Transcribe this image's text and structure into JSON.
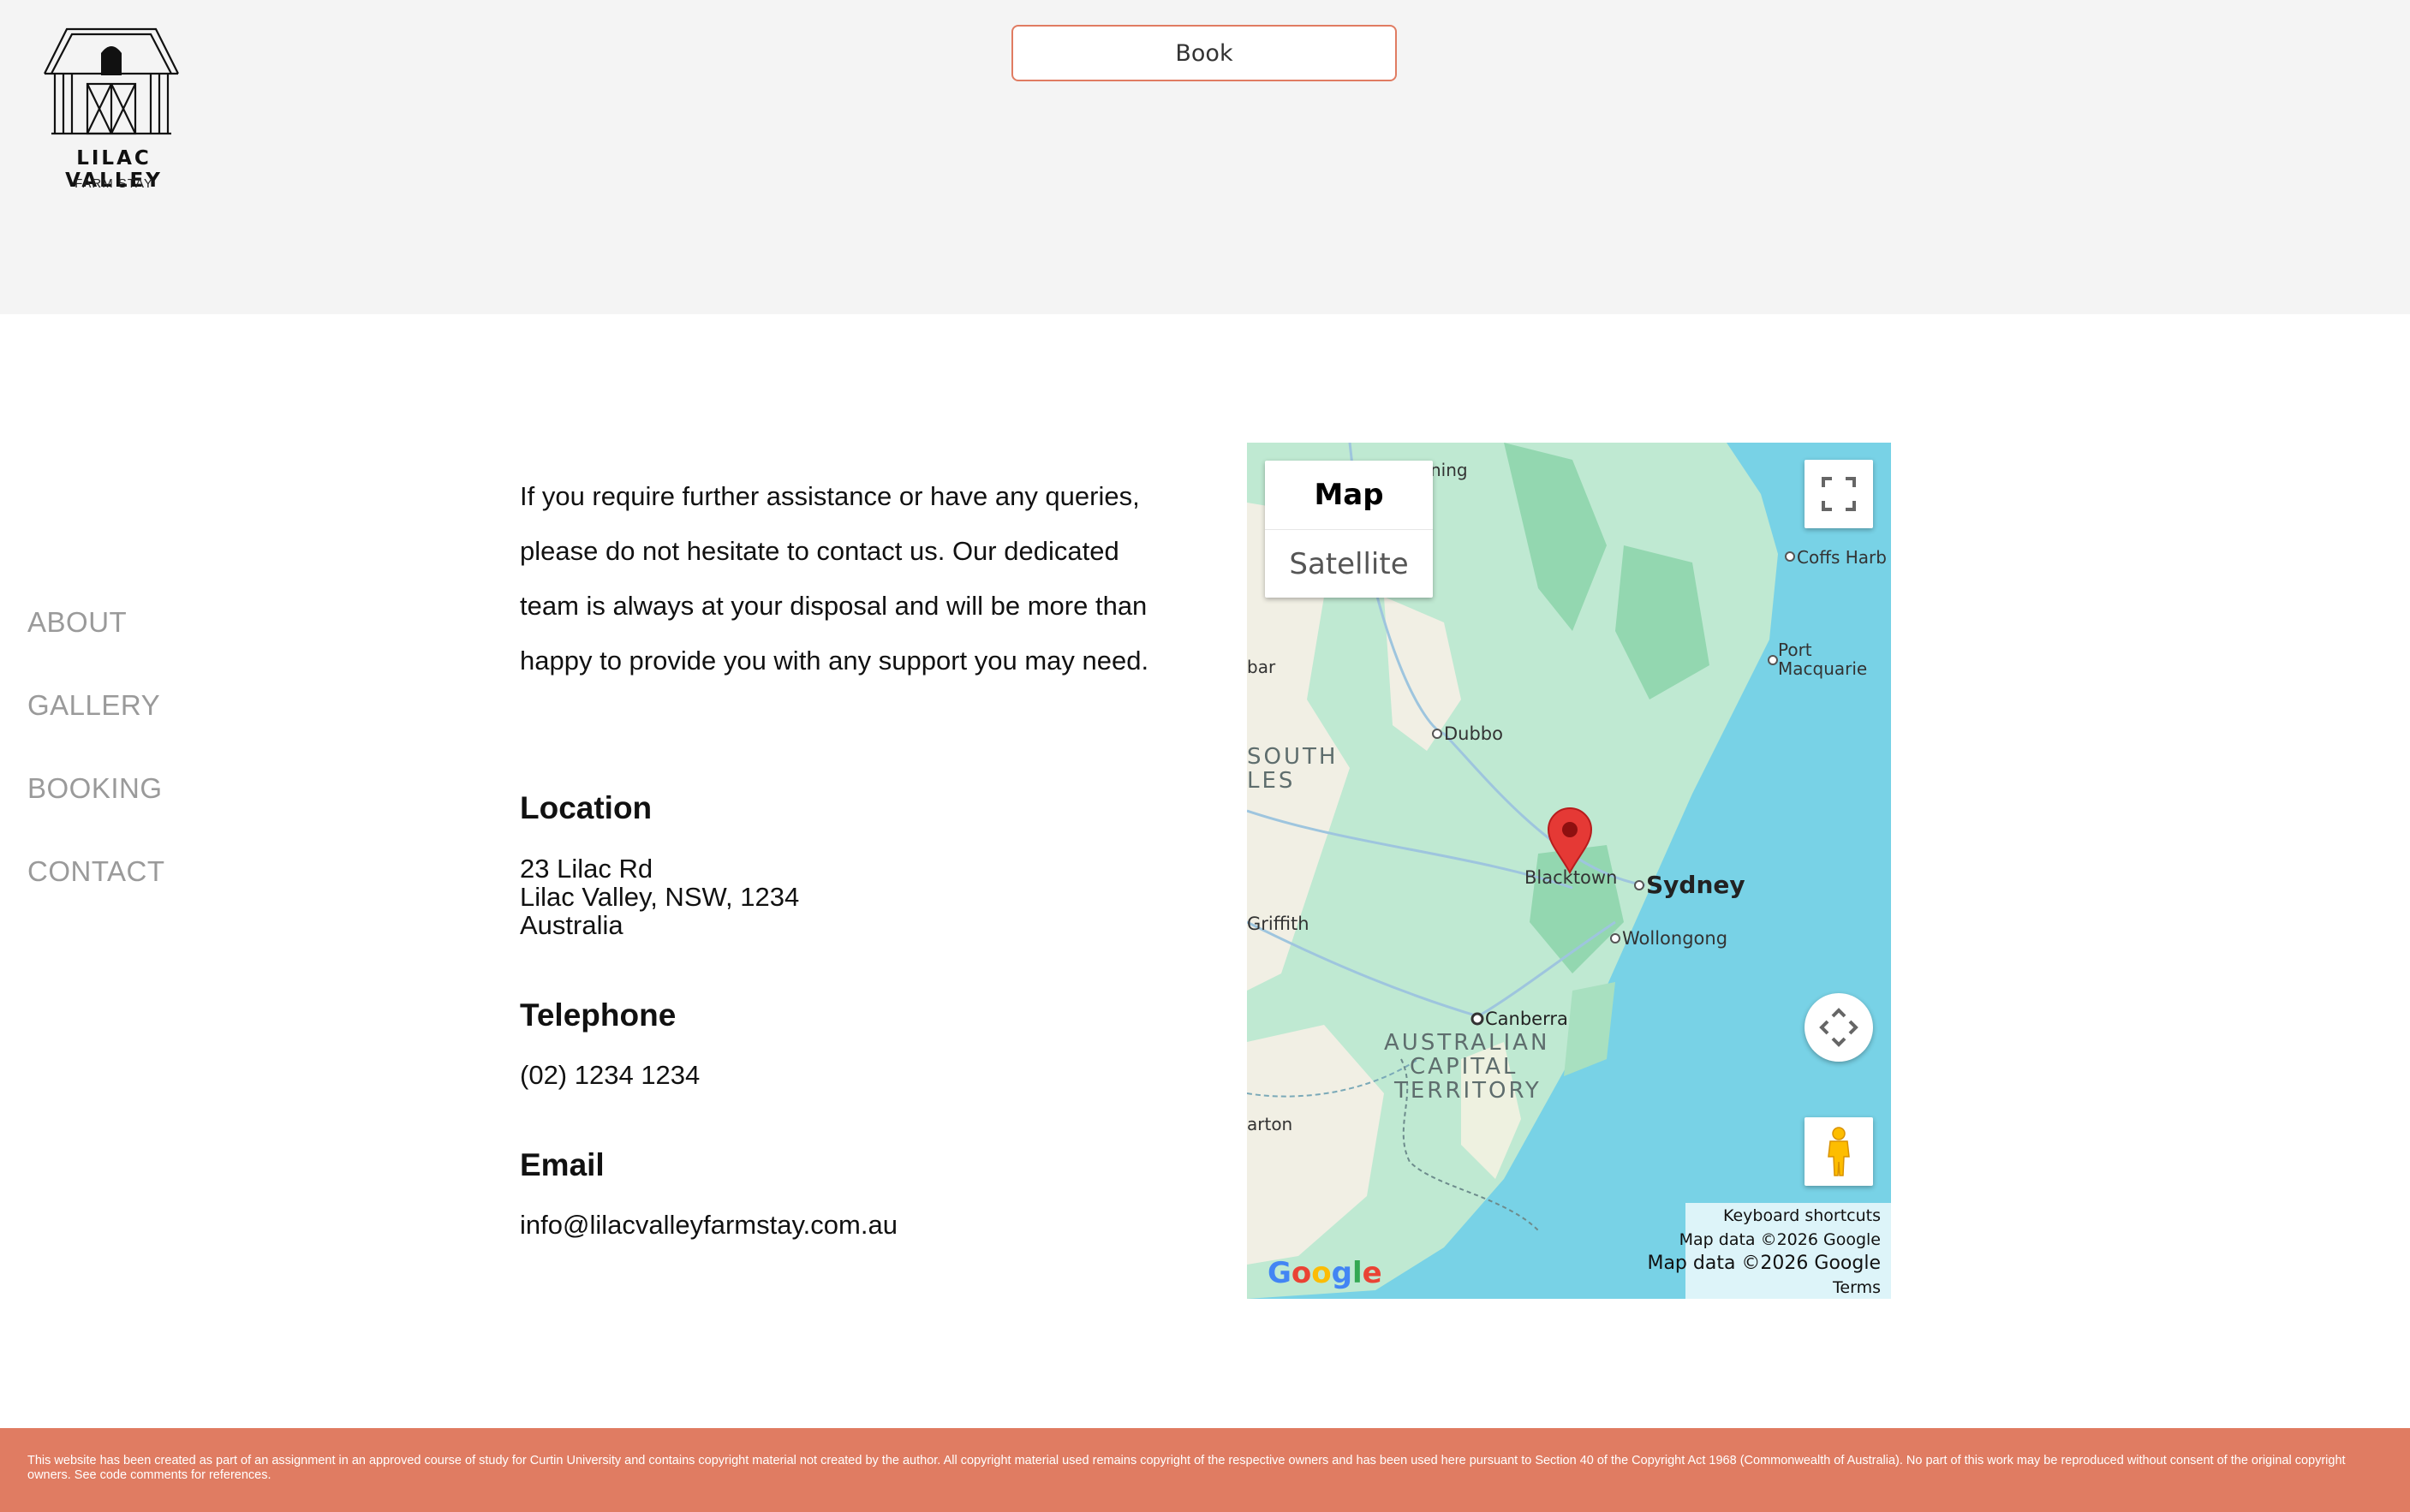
{
  "header": {
    "logo": {
      "title": "LILAC VALLEY",
      "subtitle": "FARM STAY"
    },
    "book_label": "Book"
  },
  "nav": [
    {
      "label": "ABOUT"
    },
    {
      "label": "GALLERY"
    },
    {
      "label": "BOOKING"
    },
    {
      "label": "CONTACT"
    }
  ],
  "contact": {
    "intro": "If you require further assistance or have any queries, please do not hesitate to contact us. Our dedicated team is always at your disposal and will be more than happy to provide you with any support you may need.",
    "location_heading": "Location",
    "address_line1": "23 Lilac Rd",
    "address_line2": "Lilac Valley, NSW, 1234",
    "address_line3": "Australia",
    "telephone_heading": "Telephone",
    "telephone": "(02) 1234 1234",
    "email_heading": "Email",
    "email": "info@lilacvalleyfarmstay.com.au"
  },
  "map": {
    "map_type_map": "Map",
    "map_type_satellite": "Satellite",
    "labels": {
      "coffs": "Coffs Harb",
      "port1": "Port",
      "port2": "Macquarie",
      "dubbo": "Dubbo",
      "south": "SOUTH",
      "wales": "LES",
      "blacktown": "Blacktown",
      "sydney": "Sydney",
      "wollongong": "Wollongong",
      "griffith": "Griffith",
      "canberra": "Canberra",
      "act1": "AUSTRALIAN",
      "act2": "CAPITAL",
      "act3": "TERRITORY",
      "arton": "arton",
      "bar": "bar",
      "ning": "ning",
      "google": "Google"
    },
    "attribution": {
      "keyboard": "Keyboard shortcuts",
      "data_small": "Map data ©2026 Google",
      "data_large": "Map data ©2026 Google",
      "terms": "Terms"
    },
    "colors": {
      "water": "#78d2e6",
      "land_green": "#bfe9d2",
      "land_beige": "#f1efe4",
      "pin": "#e53935"
    }
  },
  "footer": {
    "text": "This website has been created as part of an assignment in an approved course of study for Curtin University and contains copyright material not created by the author. All copyright material used remains copyright of the respective owners and has been used here pursuant to Section 40 of the Copyright Act 1968 (Commonwealth of Australia). No part of this work may be reproduced without consent of the original copyright owners. See code comments for references."
  },
  "colors": {
    "accent": "#e07c62",
    "header_bg": "#f4f4f4",
    "nav_text": "#9a9a9a"
  }
}
